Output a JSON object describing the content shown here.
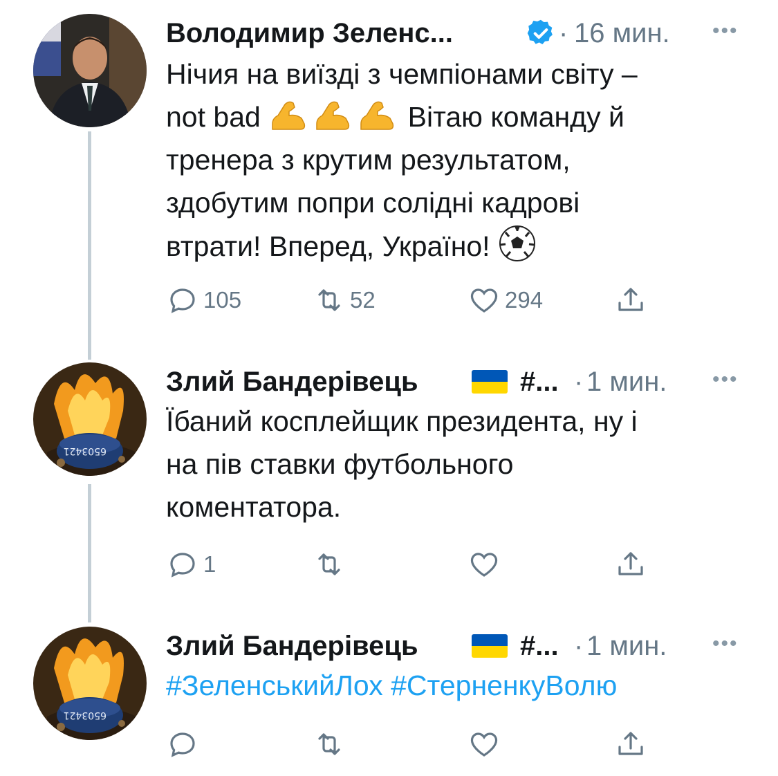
{
  "tweets": [
    {
      "author": "Володимир Зеленс...",
      "verified": true,
      "time": "16 мин.",
      "more": "•••",
      "text_line1": "Нічия на виїзді з чемпіонами світу –",
      "text_line2_a": "not bad",
      "text_line2_b": "Вітаю команду й",
      "text_line3": "тренера з крутим результатом,",
      "text_line4": "здобутим попри солідні кадрові",
      "text_line5": "втрати! Вперед, Україно!",
      "replies": "105",
      "retweets": "52",
      "likes": "294"
    },
    {
      "author": "Злий Бандерівець",
      "author_suffix": "#...",
      "time": "1 мин.",
      "more": "•••",
      "text_line1": "Їбаний косплейщик президента, ну і",
      "text_line2": "на пів ставки футбольного",
      "text_line3": "коментатора.",
      "replies": "1"
    },
    {
      "author": "Злий Бандерівець",
      "author_suffix": "#...",
      "time": "1 мин.",
      "more": "•••",
      "hashtags": "#ЗеленськийЛох #СтерненкуВолю"
    }
  ],
  "colors": {
    "text": "#14171a",
    "secondary": "#657786",
    "link": "#1da1f2",
    "thread_line": "#c4cfd6",
    "flag_blue": "#0057b7",
    "flag_yellow": "#ffd700"
  },
  "icons": [
    "reply-icon",
    "retweet-icon",
    "like-icon",
    "share-icon",
    "verified-badge-icon",
    "flexed-biceps-emoji",
    "soccer-ball-emoji",
    "ukraine-flag-emoji"
  ]
}
